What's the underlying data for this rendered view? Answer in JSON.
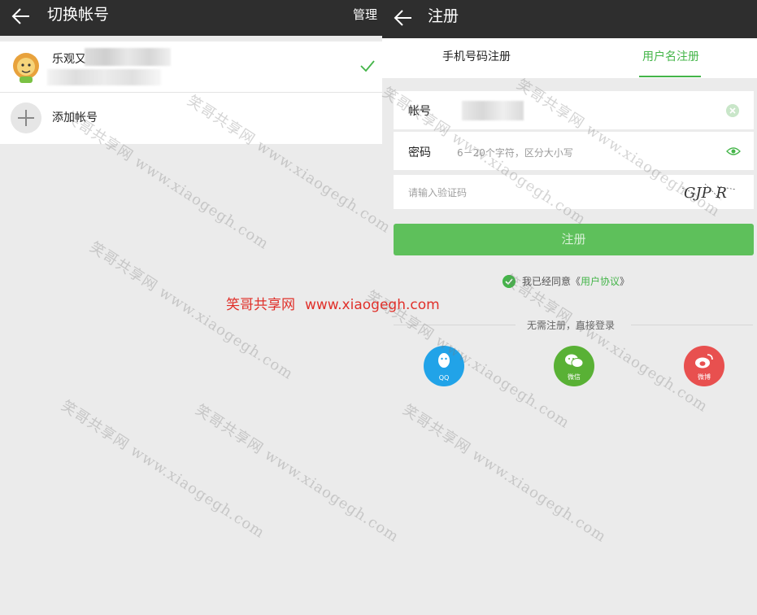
{
  "left": {
    "title": "切换帐号",
    "manage_label": "管理",
    "account_name": "乐观又",
    "add_account_label": "添加帐号"
  },
  "right": {
    "title": "注册",
    "tabs": [
      {
        "label": "手机号码注册",
        "active": false
      },
      {
        "label": "用户名注册",
        "active": true
      }
    ],
    "account_label": "帐号",
    "password_label": "密码",
    "password_placeholder": "6－20个字符，区分大小写",
    "captcha_placeholder": "请输入验证码",
    "captcha_text": "GJP R",
    "register_button": "注册",
    "agree_prefix": "我已经同意《",
    "agree_link": "用户协议",
    "agree_suffix": "》",
    "divider_text": "无需注册，直接登录",
    "social": [
      {
        "label": "QQ",
        "icon": "qq-penguin-icon",
        "color": "#21a3e8"
      },
      {
        "label": "微信",
        "icon": "wechat-icon",
        "color": "#59b135"
      },
      {
        "label": "微博",
        "icon": "weibo-icon",
        "color": "#e8504f"
      }
    ]
  },
  "colors": {
    "header": "#2e2e2e",
    "accent_green": "#44b549",
    "button_green": "#5ec05b",
    "background": "#ebebeb"
  },
  "watermark": {
    "center_name": "笑哥共享网",
    "center_url": "www.xiaogegh.com",
    "diagonal_text": "笑哥共享网 www.xiaogegh.com"
  }
}
